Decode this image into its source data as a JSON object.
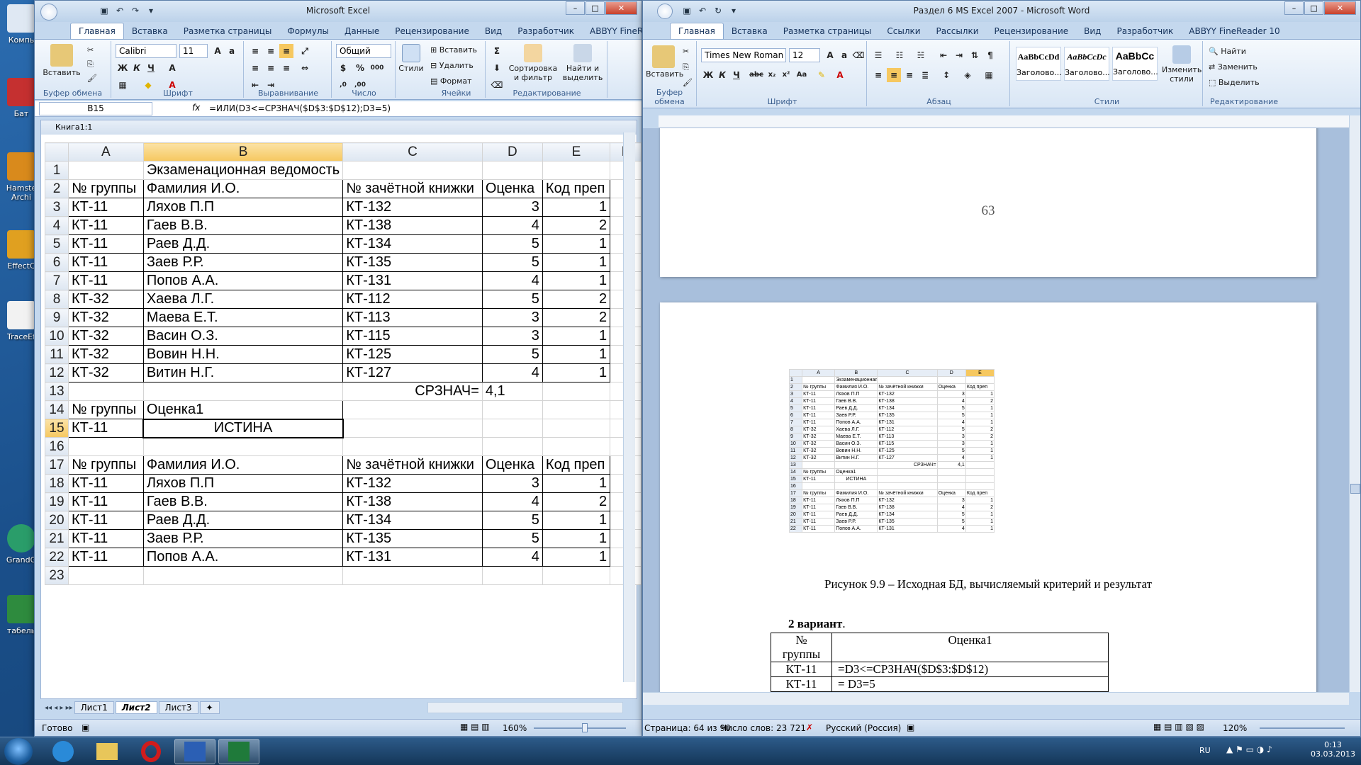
{
  "excel": {
    "title": "Microsoft Excel",
    "tabs": [
      "Главная",
      "Вставка",
      "Разметка страницы",
      "Формулы",
      "Данные",
      "Рецензирование",
      "Вид",
      "Разработчик",
      "ABBYY FineReader 10"
    ],
    "ribbon": {
      "paste": "Вставить",
      "font_name": "Calibri",
      "font_size": "11",
      "number_format": "Общий",
      "styles": "Стили",
      "insert": "Вставить",
      "delete": "Удалить",
      "format": "Формат",
      "sort_filter": "Сортировка и фильтр",
      "find_select": "Найти и выделить",
      "groups": [
        "Буфер обмена",
        "Шрифт",
        "Выравнивание",
        "Число",
        "Ячейки",
        "Редактирование"
      ]
    },
    "name_box": "B15",
    "formula": "=ИЛИ(D3<=СРЗНАЧ($D$3:$D$12);D3=5)",
    "workbook_title": "Книга1:1",
    "columns": [
      "A",
      "B",
      "C",
      "D",
      "E",
      "F"
    ],
    "rows": [
      [
        "1",
        "",
        "Экзаменационная ведомость",
        "",
        "",
        "",
        ""
      ],
      [
        "2",
        "№ группы",
        "Фамилия И.О.",
        "№ зачётной книжки",
        "Оценка",
        "Код преп",
        ""
      ],
      [
        "3",
        "КТ-11",
        "Ляхов П.П",
        "КТ-132",
        "3",
        "1",
        ""
      ],
      [
        "4",
        "КТ-11",
        "Гаев В.В.",
        "КТ-138",
        "4",
        "2",
        ""
      ],
      [
        "5",
        "КТ-11",
        "Раев Д.Д.",
        "КТ-134",
        "5",
        "1",
        ""
      ],
      [
        "6",
        "КТ-11",
        "Заев Р.Р.",
        "КТ-135",
        "5",
        "1",
        ""
      ],
      [
        "7",
        "КТ-11",
        "Попов А.А.",
        "КТ-131",
        "4",
        "1",
        ""
      ],
      [
        "8",
        "КТ-32",
        "Хаева Л.Г.",
        "КТ-112",
        "5",
        "2",
        ""
      ],
      [
        "9",
        "КТ-32",
        "Маева Е.Т.",
        "КТ-113",
        "3",
        "2",
        ""
      ],
      [
        "10",
        "КТ-32",
        "Васин О.З.",
        "КТ-115",
        "3",
        "1",
        ""
      ],
      [
        "11",
        "КТ-32",
        "Вовин Н.Н.",
        "КТ-125",
        "5",
        "1",
        ""
      ],
      [
        "12",
        "КТ-32",
        "Витин Н.Г.",
        "КТ-127",
        "4",
        "1",
        ""
      ],
      [
        "13",
        "",
        "",
        "СРЗНАЧ=",
        "4,1",
        "",
        ""
      ],
      [
        "14",
        "№ группы",
        "Оценка1",
        "",
        "",
        "",
        ""
      ],
      [
        "15",
        "КТ-11",
        "ИСТИНА",
        "",
        "",
        "",
        ""
      ],
      [
        "16",
        "",
        "",
        "",
        "",
        "",
        ""
      ],
      [
        "17",
        "№ группы",
        "Фамилия И.О.",
        "№ зачётной книжки",
        "Оценка",
        "Код преп",
        ""
      ],
      [
        "18",
        "КТ-11",
        "Ляхов П.П",
        "КТ-132",
        "3",
        "1",
        ""
      ],
      [
        "19",
        "КТ-11",
        "Гаев В.В.",
        "КТ-138",
        "4",
        "2",
        ""
      ],
      [
        "20",
        "КТ-11",
        "Раев Д.Д.",
        "КТ-134",
        "5",
        "1",
        ""
      ],
      [
        "21",
        "КТ-11",
        "Заев Р.Р.",
        "КТ-135",
        "5",
        "1",
        ""
      ],
      [
        "22",
        "КТ-11",
        "Попов А.А.",
        "КТ-131",
        "4",
        "1",
        ""
      ],
      [
        "23",
        "",
        "",
        "",
        "",
        "",
        ""
      ]
    ],
    "sheets": [
      "Лист1",
      "Лист2",
      "Лист3"
    ],
    "active_sheet": "Лист2",
    "status": "Готово",
    "zoom": "160%"
  },
  "word": {
    "title": "Раздел 6 MS Excel 2007 - Microsoft Word",
    "tabs": [
      "Главная",
      "Вставка",
      "Разметка страницы",
      "Ссылки",
      "Рассылки",
      "Рецензирование",
      "Вид",
      "Разработчик",
      "ABBYY FineReader 10"
    ],
    "ribbon": {
      "paste": "Вставить",
      "font_name": "Times New Roman",
      "font_size": "12",
      "styles": [
        "AaBbCcDd",
        "AaBbCcDc",
        "AaBbCc"
      ],
      "style_names": [
        "Заголово...",
        "Заголово...",
        "Заголово..."
      ],
      "change_styles": "Изменить стили",
      "find": "Найти",
      "replace": "Заменить",
      "select": "Выделить",
      "groups": [
        "Буфер обмена",
        "Шрифт",
        "Абзац",
        "Стили",
        "Редактирование"
      ]
    },
    "page_number": "63",
    "caption": "Рисунок 9.9 – Исходная БД, вычисляемый критерий и результат",
    "variant": "2 вариант",
    "table": {
      "headers": [
        "№ группы",
        "Оценка1"
      ],
      "rows": [
        [
          "КТ-11",
          "=D3<=СРЗНАЧ($D$3:$D$12)"
        ],
        [
          "КТ-11",
          "= D3=5"
        ]
      ]
    },
    "status": {
      "page": "Страница: 64 из 90",
      "words": "Число слов: 23 721",
      "lang": "Русский (Россия)",
      "zoom": "120%"
    }
  },
  "desktop_icons": [
    "Компь",
    "Бат",
    "Hamste Archi",
    "EffectC",
    "TraceEf",
    "GrandG",
    "табель"
  ],
  "taskbar": {
    "lang": "RU",
    "time": "0:13",
    "date": "03.03.2013"
  }
}
